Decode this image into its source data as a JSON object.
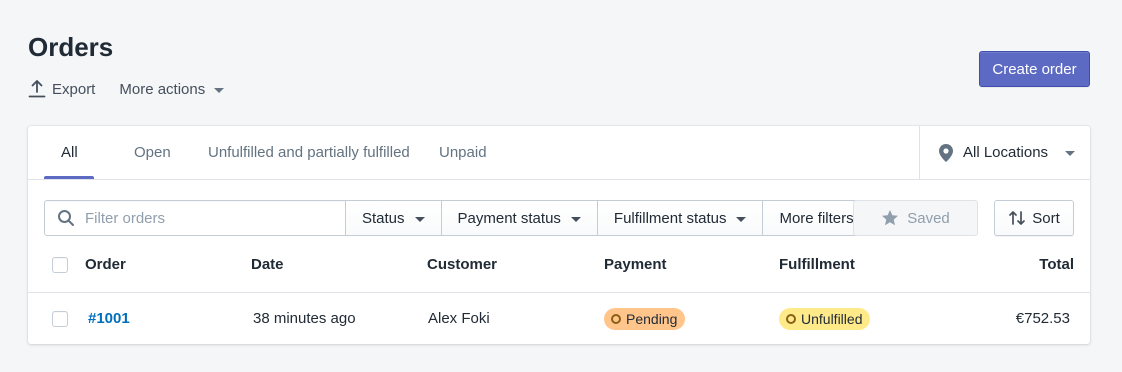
{
  "page": {
    "title": "Orders",
    "export_label": "Export",
    "more_actions_label": "More actions",
    "create_label": "Create order"
  },
  "tabs": [
    {
      "label": "All",
      "active": true
    },
    {
      "label": "Open",
      "active": false
    },
    {
      "label": "Unfulfilled and partially fulfilled",
      "active": false
    },
    {
      "label": "Unpaid",
      "active": false
    }
  ],
  "location": {
    "label": "All Locations",
    "icon": "location-pin-icon"
  },
  "filters": {
    "search_placeholder": "Filter orders",
    "status_label": "Status",
    "payment_status_label": "Payment status",
    "fulfillment_status_label": "Fulfillment status",
    "more_filters_label": "More filters",
    "saved_label": "Saved",
    "sort_label": "Sort"
  },
  "table": {
    "columns": [
      "Order",
      "Date",
      "Customer",
      "Payment",
      "Fulfillment",
      "Total"
    ],
    "rows": [
      {
        "order": "#1001",
        "date": "38 minutes ago",
        "customer": "Alex Foki",
        "payment": "Pending",
        "fulfillment": "Unfulfilled",
        "total": "€752.53"
      }
    ]
  },
  "colors": {
    "accent": "#5c6ac4",
    "link": "#006fbb",
    "pending_badge": "#ffc58b",
    "unfulfilled_badge": "#ffea8a"
  }
}
